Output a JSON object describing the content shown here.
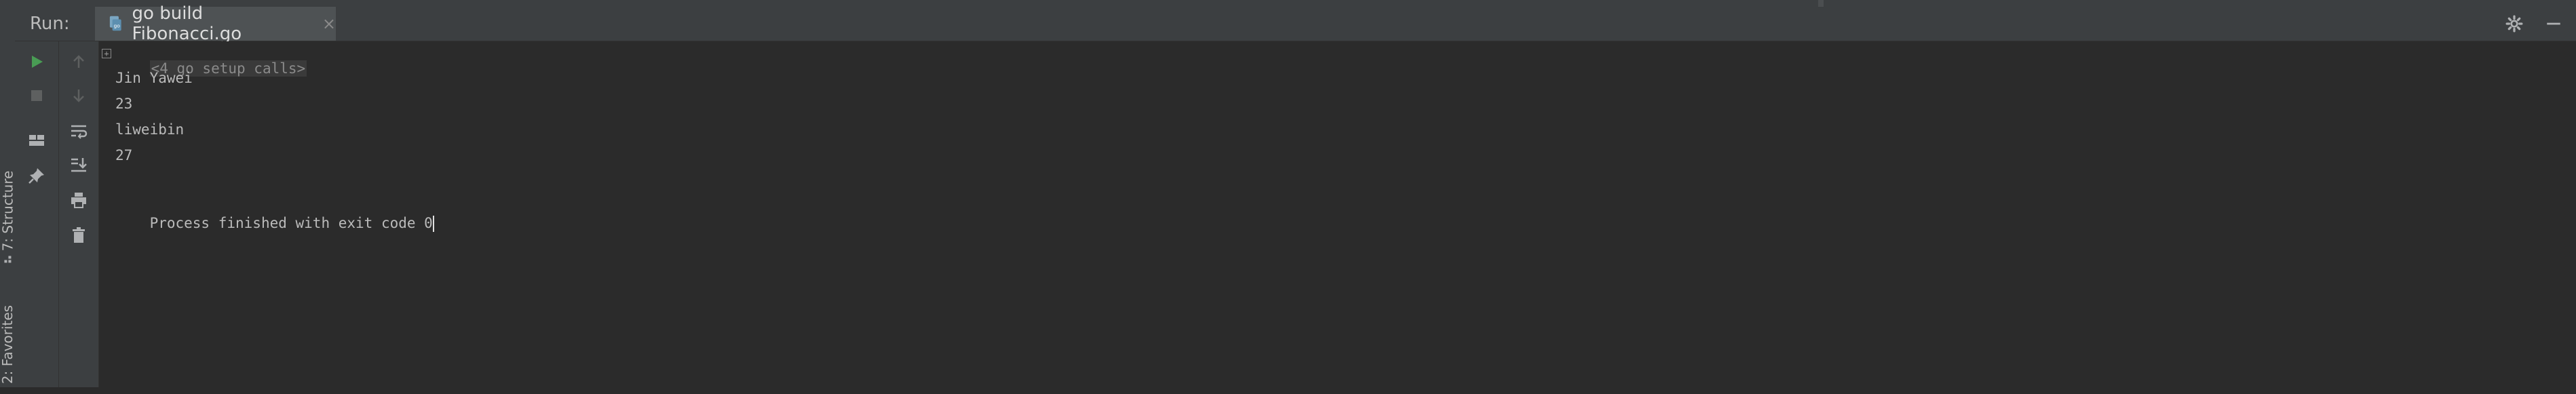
{
  "header": {
    "run_label": "Run:",
    "tab_label": "go build Fibonacci.go",
    "tab_close": "×"
  },
  "left_strip": {
    "structure_label": "7: Structure",
    "favorites_label": "2: Favorites"
  },
  "console": {
    "fold_marker": "+",
    "setup_calls": "<4 go setup calls>",
    "lines": [
      "Jin Yawei",
      "23",
      "liweibin",
      "27"
    ],
    "process_text": "Process finished with exit code 0"
  },
  "colors": {
    "run_green": "#499c54",
    "stop_gray": "#5e6060",
    "icon_gray": "#afb1b3"
  }
}
